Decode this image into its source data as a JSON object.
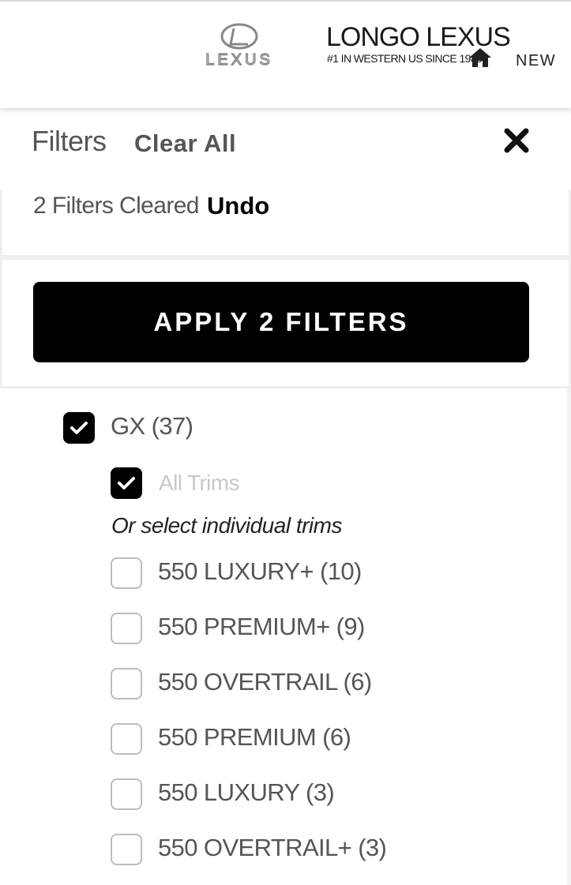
{
  "header": {
    "logo_alt": "LEXUS",
    "dealer_name": "LONGO LEXUS",
    "dealer_tagline": "#1 IN WESTERN US SINCE 1985*",
    "home_icon": "home-icon",
    "new_link": "NEW"
  },
  "filters": {
    "title": "Filters",
    "clear_all": "Clear All",
    "close_icon": "close-icon",
    "cleared_message": "2 Filters Cleared",
    "undo": "Undo",
    "apply_button": "APPLY 2 FILTERS"
  },
  "model": {
    "label": "GX (37)",
    "checked": true,
    "all_trims": {
      "label": "All Trims",
      "checked": true
    },
    "hint": "Or select individual trims",
    "trims": [
      {
        "label": "550 LUXURY+ (10)",
        "checked": false
      },
      {
        "label": "550 PREMIUM+ (9)",
        "checked": false
      },
      {
        "label": "550 OVERTRAIL (6)",
        "checked": false
      },
      {
        "label": "550 PREMIUM (6)",
        "checked": false
      },
      {
        "label": "550 LUXURY (3)",
        "checked": false
      },
      {
        "label": "550 OVERTRAIL+ (3)",
        "checked": false
      }
    ]
  },
  "colors": {
    "primary": "#000000",
    "muted_text": "#555555",
    "border": "#eeeeee"
  }
}
